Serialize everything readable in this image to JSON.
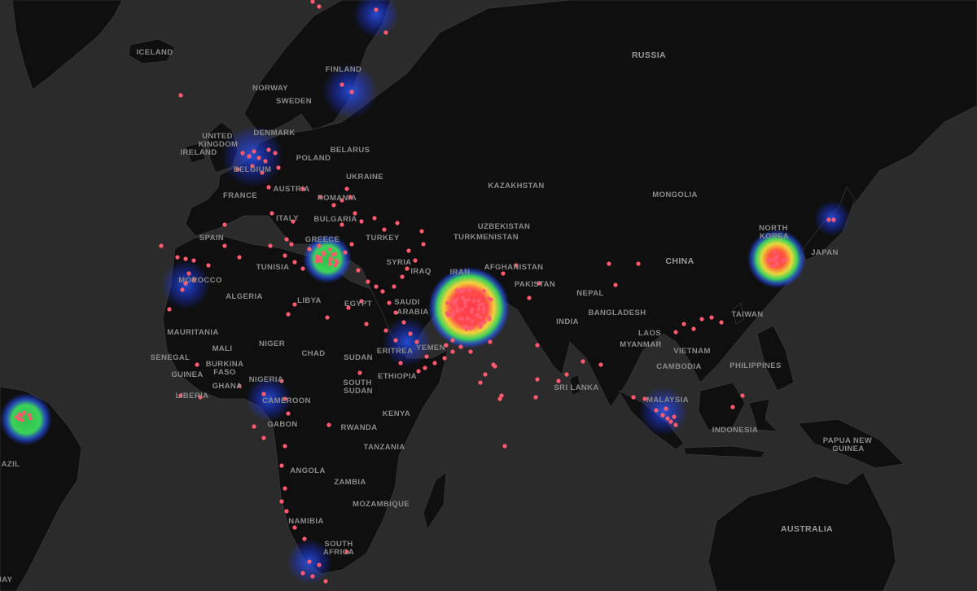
{
  "map": {
    "labels": [
      {
        "id": "iceland",
        "text": "ICELAND"
      },
      {
        "id": "norway",
        "text": "NORWAY"
      },
      {
        "id": "sweden",
        "text": "SWEDEN"
      },
      {
        "id": "finland",
        "text": "FINLAND"
      },
      {
        "id": "russia",
        "text": "RUSSIA"
      },
      {
        "id": "united-kingdom-1",
        "text": "UNITED"
      },
      {
        "id": "united-kingdom-2",
        "text": "KINGDOM"
      },
      {
        "id": "ireland",
        "text": "IRELAND"
      },
      {
        "id": "denmark",
        "text": "DENMARK"
      },
      {
        "id": "belgium",
        "text": "BELGIUM"
      },
      {
        "id": "poland",
        "text": "POLAND"
      },
      {
        "id": "belarus",
        "text": "BELARUS"
      },
      {
        "id": "ukraine",
        "text": "UKRAINE"
      },
      {
        "id": "france",
        "text": "FRANCE"
      },
      {
        "id": "austria",
        "text": "AUSTRIA"
      },
      {
        "id": "romania",
        "text": "ROMANIA"
      },
      {
        "id": "bulgaria",
        "text": "BULGARIA"
      },
      {
        "id": "italy",
        "text": "ITALY"
      },
      {
        "id": "greece",
        "text": "GREECE"
      },
      {
        "id": "turkey",
        "text": "TURKEY"
      },
      {
        "id": "spain",
        "text": "SPAIN"
      },
      {
        "id": "tunisia",
        "text": "TUNISIA"
      },
      {
        "id": "morocco",
        "text": "MOROCCO"
      },
      {
        "id": "algeria",
        "text": "ALGERIA"
      },
      {
        "id": "libya",
        "text": "LIBYA"
      },
      {
        "id": "egypt",
        "text": "EGYPT"
      },
      {
        "id": "syria",
        "text": "SYRIA"
      },
      {
        "id": "iraq",
        "text": "IRAQ"
      },
      {
        "id": "iran",
        "text": "IRAN"
      },
      {
        "id": "saudi-1",
        "text": "SAUDI"
      },
      {
        "id": "saudi-2",
        "text": "ARABIA"
      },
      {
        "id": "kazakhstan",
        "text": "KAZAKHSTAN"
      },
      {
        "id": "uzbekistan",
        "text": "UZBEKISTAN"
      },
      {
        "id": "turkmenistan",
        "text": "TURKMENISTAN"
      },
      {
        "id": "afghanistan",
        "text": "AFGHANISTAN"
      },
      {
        "id": "pakistan",
        "text": "PAKISTAN"
      },
      {
        "id": "mongolia",
        "text": "MONGOLIA"
      },
      {
        "id": "china",
        "text": "CHINA"
      },
      {
        "id": "north-korea-1",
        "text": "NORTH"
      },
      {
        "id": "north-korea-2",
        "text": "KOREA"
      },
      {
        "id": "japan",
        "text": "JAPAN"
      },
      {
        "id": "nepal",
        "text": "NEPAL"
      },
      {
        "id": "bangladesh",
        "text": "BANGLADESH"
      },
      {
        "id": "india",
        "text": "INDIA"
      },
      {
        "id": "taiwan",
        "text": "TAIWAN"
      },
      {
        "id": "myanmar",
        "text": "MYANMAR"
      },
      {
        "id": "laos",
        "text": "LAOS"
      },
      {
        "id": "vietnam",
        "text": "VIETNAM"
      },
      {
        "id": "cambodia",
        "text": "CAMBODIA"
      },
      {
        "id": "philippines",
        "text": "PHILIPPINES"
      },
      {
        "id": "sri-lanka",
        "text": "SRI LANKA"
      },
      {
        "id": "malaysia",
        "text": "MALAYSIA"
      },
      {
        "id": "indonesia",
        "text": "INDONESIA"
      },
      {
        "id": "papua-1",
        "text": "PAPUA NEW"
      },
      {
        "id": "papua-2",
        "text": "GUINEA"
      },
      {
        "id": "australia",
        "text": "AUSTRALIA"
      },
      {
        "id": "mauritania",
        "text": "MAURITANIA"
      },
      {
        "id": "mali",
        "text": "MALI"
      },
      {
        "id": "niger",
        "text": "NIGER"
      },
      {
        "id": "chad",
        "text": "CHAD"
      },
      {
        "id": "sudan",
        "text": "SUDAN"
      },
      {
        "id": "eritrea",
        "text": "ERITREA"
      },
      {
        "id": "yemen",
        "text": "YEMEN"
      },
      {
        "id": "senegal",
        "text": "SENEGAL"
      },
      {
        "id": "burkina-1",
        "text": "BURKINA"
      },
      {
        "id": "burkina-2",
        "text": "FASO"
      },
      {
        "id": "guinea",
        "text": "GUINEA"
      },
      {
        "id": "ghana",
        "text": "GHANA"
      },
      {
        "id": "liberia",
        "text": "LIBERIA"
      },
      {
        "id": "nigeria",
        "text": "NIGERIA"
      },
      {
        "id": "cameroon",
        "text": "CAMEROON"
      },
      {
        "id": "south-sudan-1",
        "text": "SOUTH"
      },
      {
        "id": "south-sudan-2",
        "text": "SUDAN"
      },
      {
        "id": "ethiopia",
        "text": "ETHIOPIA"
      },
      {
        "id": "gabon",
        "text": "GABON"
      },
      {
        "id": "kenya",
        "text": "KENYA"
      },
      {
        "id": "rwanda",
        "text": "RWANDA"
      },
      {
        "id": "tanzania",
        "text": "TANZANIA"
      },
      {
        "id": "angola",
        "text": "ANGOLA"
      },
      {
        "id": "zambia",
        "text": "ZAMBIA"
      },
      {
        "id": "mozambique",
        "text": "MOZAMBIQUE"
      },
      {
        "id": "namibia",
        "text": "NAMIBIA"
      },
      {
        "id": "south-africa-1",
        "text": "SOUTH"
      },
      {
        "id": "south-africa-2",
        "text": "AFRICA"
      },
      {
        "id": "brazil",
        "text": "AZIL"
      },
      {
        "id": "uruguay",
        "text": "JAY"
      }
    ],
    "colors": {
      "background": "#2b2b2b",
      "land": "#0f0f10",
      "borders": "#3a3a3c",
      "labels": "#8a8a8a",
      "points": "#ff5a6e",
      "heat_low": "#1e3cff",
      "heat_mid": "#3cd25a",
      "heat_high": "#ff3b4a"
    }
  }
}
